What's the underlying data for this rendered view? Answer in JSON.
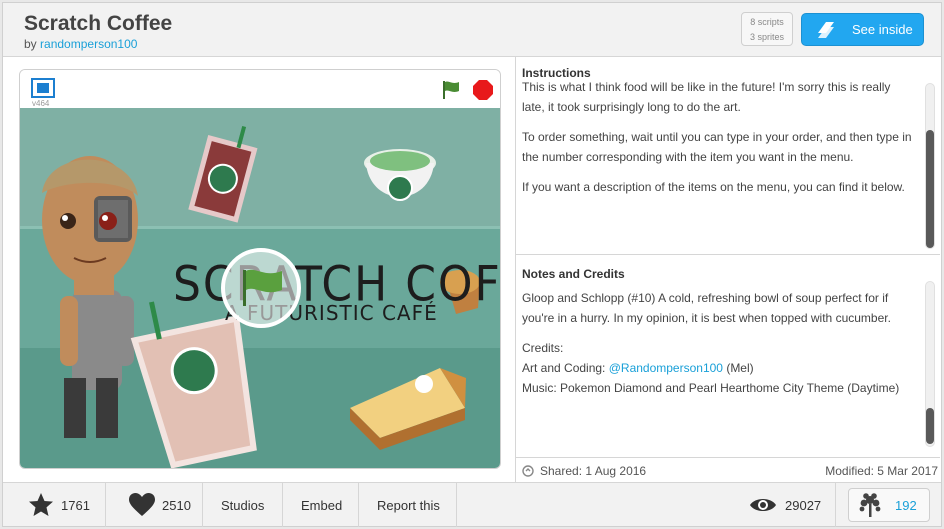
{
  "header": {
    "title": "Scratch Coffee",
    "by": "by",
    "author": "randomperson100",
    "scripts": "8 scripts",
    "sprites": "3 sprites",
    "see_inside": "See inside"
  },
  "player": {
    "version": "v464",
    "stage_title": "SCRATCH COFFEE",
    "stage_subtitle": "A FUTURISTIC CAFÉ"
  },
  "instructions": {
    "heading": "Instructions",
    "p1": "This is what I think food will be like in the future! I'm sorry this is really late, it took surprisingly long to do the art.",
    "p2": "To order something, wait until you can type in your order, and then type in the number corresponding with the item you want in the menu.",
    "p3": "If you want a description of the items on the menu, you can find it below."
  },
  "notes": {
    "heading": "Notes and Credits",
    "p1": "Gloop and Schlopp (#10) A cold, refreshing bowl of soup perfect for if you're in a hurry. In my opinion, it is best when topped with cucumber.",
    "credits": "Credits:",
    "art_prefix": "Art and Coding: ",
    "art_link": "@Randomperson100",
    "art_suffix": " (Mel)",
    "music": "Music: Pokemon Diamond and Pearl Hearthome City Theme (Daytime)"
  },
  "meta": {
    "shared": "Shared: 1 Aug 2016",
    "modified": "Modified: 5 Mar 2017"
  },
  "bottom": {
    "favorites": "1761",
    "loves": "2510",
    "studios": "Studios",
    "embed": "Embed",
    "report": "Report this",
    "views": "29027",
    "remixes": "192"
  },
  "colors": {
    "accent": "#22a7f0",
    "link": "#1aa0d8",
    "stage_bg": "#6aa89a"
  }
}
